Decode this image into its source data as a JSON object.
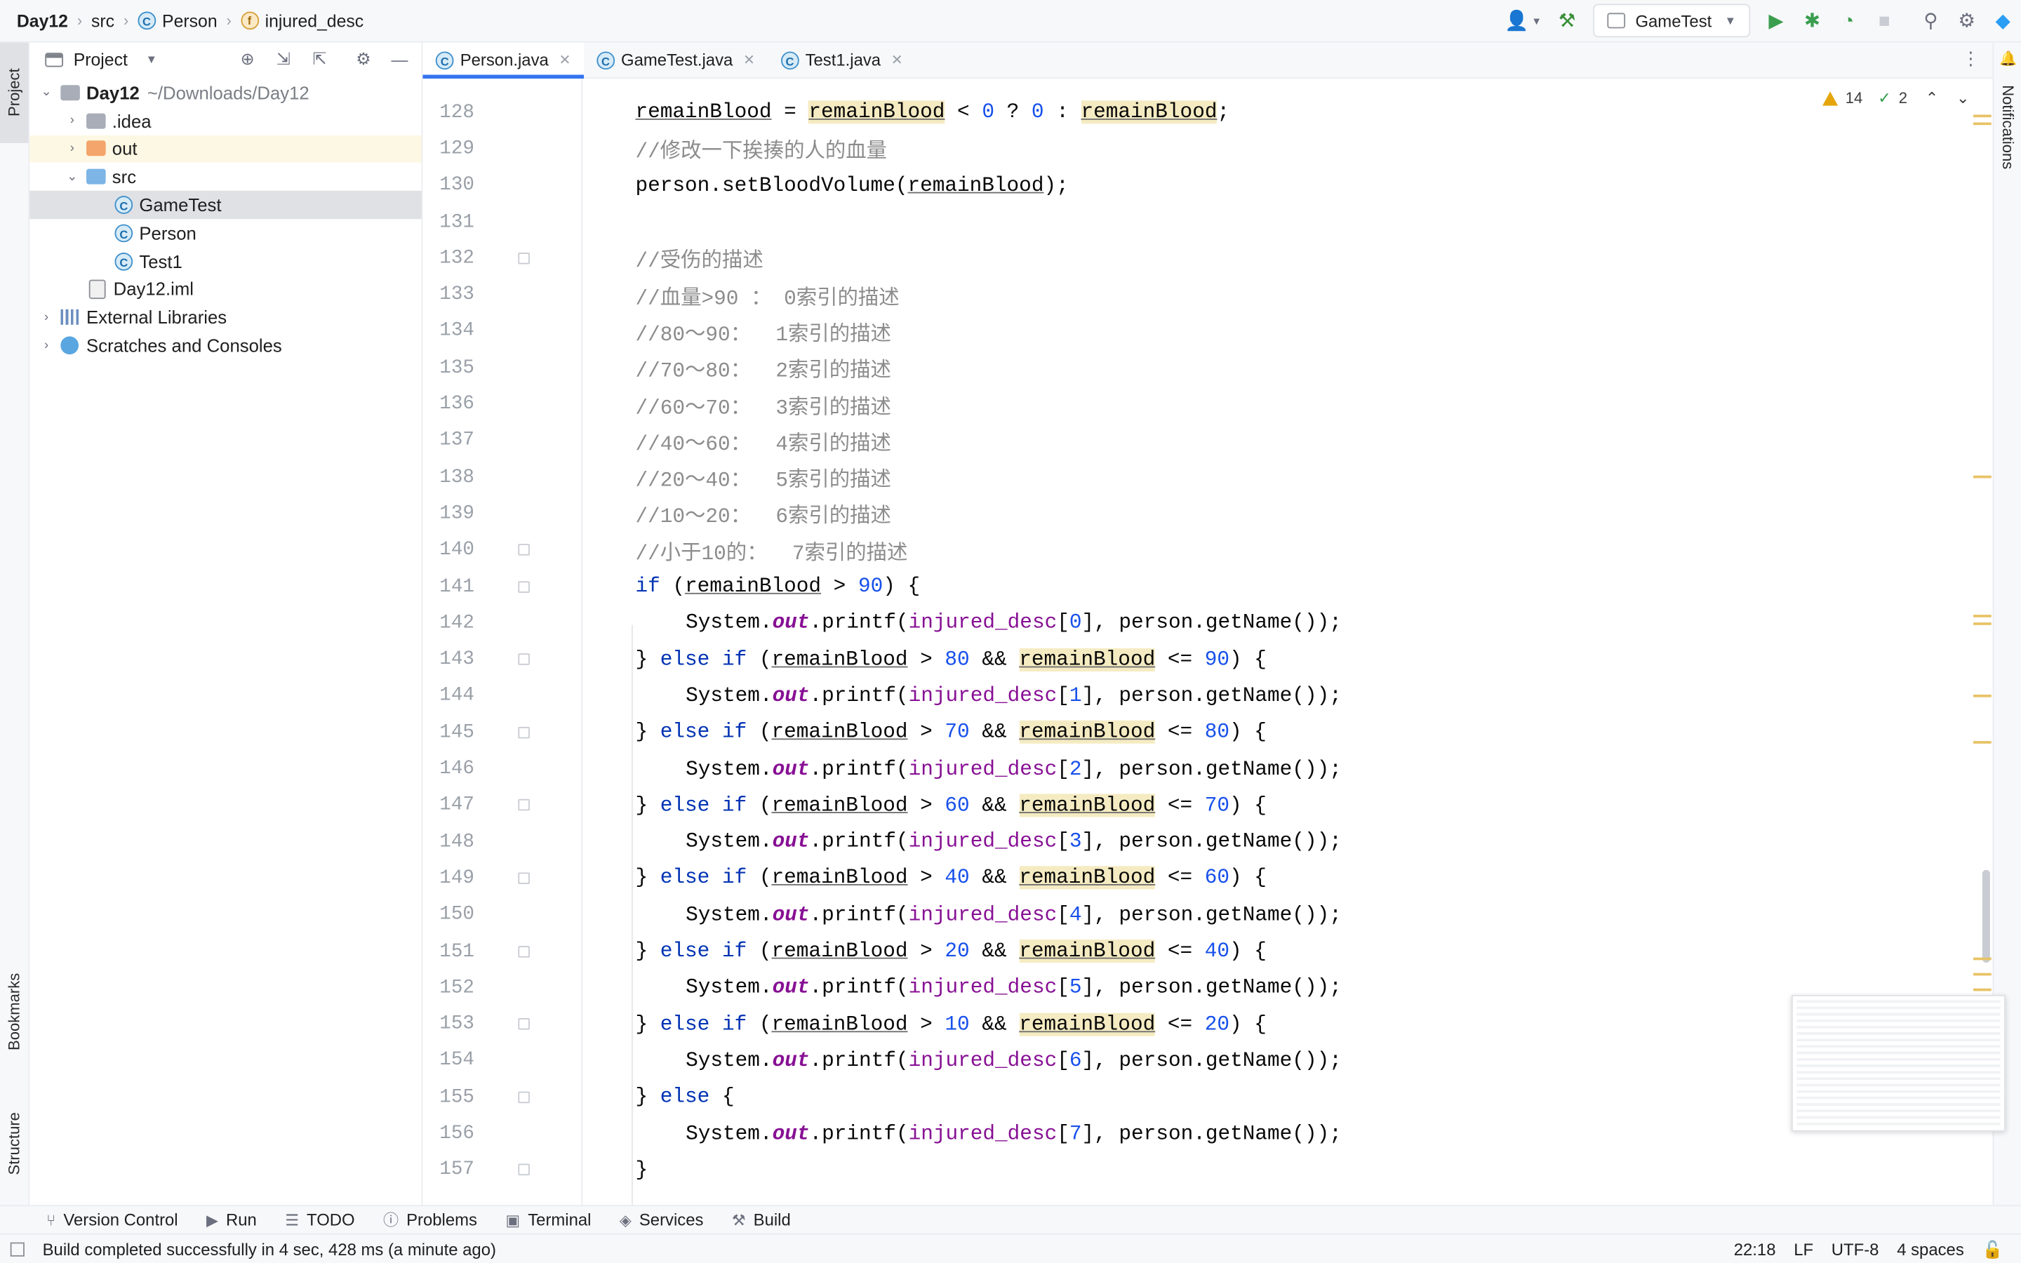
{
  "breadcrumb": {
    "project": "Day12",
    "folder": "src",
    "class": "Person",
    "field": "injured_desc"
  },
  "toolbar": {
    "run_config": "GameTest"
  },
  "left_strip": {
    "project": "Project",
    "bookmarks": "Bookmarks",
    "structure": "Structure"
  },
  "right_strip": {
    "notifications": "Notifications"
  },
  "project_panel": {
    "title": "Project",
    "tree": [
      {
        "label": "Day12",
        "extra": "~/Downloads/Day12"
      },
      {
        "label": ".idea"
      },
      {
        "label": "out"
      },
      {
        "label": "src"
      },
      {
        "label": "GameTest"
      },
      {
        "label": "Person"
      },
      {
        "label": "Test1"
      },
      {
        "label": "Day12.iml"
      },
      {
        "label": "External Libraries"
      },
      {
        "label": "Scratches and Consoles"
      }
    ]
  },
  "tabs": [
    {
      "label": "Person.java"
    },
    {
      "label": "GameTest.java"
    },
    {
      "label": "Test1.java"
    }
  ],
  "inspections": {
    "warnings": "14",
    "weak_warnings": "2"
  },
  "code": {
    "lines": [
      {
        "n": "128",
        "text": "remainBlood = remainBlood < 0 ? 0 : remainBlood;"
      },
      {
        "n": "129",
        "text": "//修改一下挨揍的人的血量"
      },
      {
        "n": "130",
        "text": "person.setBloodVolume(remainBlood);"
      },
      {
        "n": "131",
        "text": ""
      },
      {
        "n": "132",
        "text": "//受伤的描述"
      },
      {
        "n": "133",
        "text": "//血量>90 ： 0索引的描述"
      },
      {
        "n": "134",
        "text": "//80～90：  1索引的描述"
      },
      {
        "n": "135",
        "text": "//70～80：  2索引的描述"
      },
      {
        "n": "136",
        "text": "//60～70：  3索引的描述"
      },
      {
        "n": "137",
        "text": "//40～60：  4索引的描述"
      },
      {
        "n": "138",
        "text": "//20～40：  5索引的描述"
      },
      {
        "n": "139",
        "text": "//10～20：  6索引的描述"
      },
      {
        "n": "140",
        "text": "//小于10的：  7索引的描述"
      },
      {
        "n": "141",
        "text": "if (remainBlood > 90) {"
      },
      {
        "n": "142",
        "text": "System.out.printf(injured_desc[0], person.getName());"
      },
      {
        "n": "143",
        "text": "} else if (remainBlood > 80 && remainBlood <= 90) {"
      },
      {
        "n": "144",
        "text": "System.out.printf(injured_desc[1], person.getName());"
      },
      {
        "n": "145",
        "text": "} else if (remainBlood > 70 && remainBlood <= 80) {"
      },
      {
        "n": "146",
        "text": "System.out.printf(injured_desc[2], person.getName());"
      },
      {
        "n": "147",
        "text": "} else if (remainBlood > 60 && remainBlood <= 70) {"
      },
      {
        "n": "148",
        "text": "System.out.printf(injured_desc[3], person.getName());"
      },
      {
        "n": "149",
        "text": "} else if (remainBlood > 40 && remainBlood <= 60) {"
      },
      {
        "n": "150",
        "text": "System.out.printf(injured_desc[4], person.getName());"
      },
      {
        "n": "151",
        "text": "} else if (remainBlood > 20 && remainBlood <= 40) {"
      },
      {
        "n": "152",
        "text": "System.out.printf(injured_desc[5], person.getName());"
      },
      {
        "n": "153",
        "text": "} else if (remainBlood > 10 && remainBlood <= 20) {"
      },
      {
        "n": "154",
        "text": "System.out.printf(injured_desc[6], person.getName());"
      },
      {
        "n": "155",
        "text": "} else {"
      },
      {
        "n": "156",
        "text": "System.out.printf(injured_desc[7], person.getName());"
      },
      {
        "n": "157",
        "text": "}"
      }
    ]
  },
  "bottom_tools": [
    {
      "label": "Version Control"
    },
    {
      "label": "Run"
    },
    {
      "label": "TODO"
    },
    {
      "label": "Problems"
    },
    {
      "label": "Terminal"
    },
    {
      "label": "Services"
    },
    {
      "label": "Build"
    }
  ],
  "status": {
    "message": "Build completed successfully in 4 sec, 428 ms (a minute ago)",
    "position": "22:18",
    "line_sep": "LF",
    "encoding": "UTF-8",
    "indent": "4 spaces"
  },
  "colors": {
    "keyword": "#0033b3",
    "number": "#1750eb",
    "comment": "#8c8c8c",
    "field": "#871094",
    "highlight": "#f5ebc2",
    "accent": "#3574f0"
  }
}
